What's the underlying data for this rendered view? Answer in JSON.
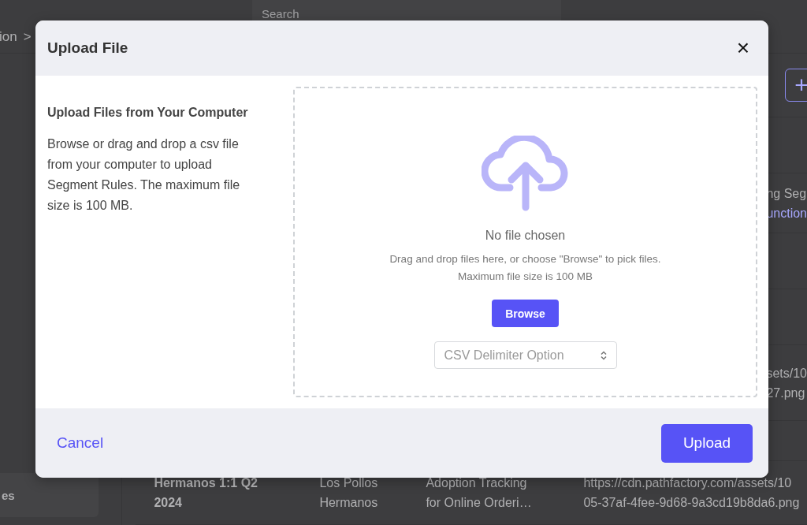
{
  "background": {
    "search": {
      "placeholder": "Search"
    },
    "breadcrumb": {
      "crumb": "ion",
      "separator": ">"
    },
    "add_button": "+",
    "sidebar_item": "es",
    "table_rows": [
      {
        "column_5": "ng Seg",
        "column_5_link": "unction"
      },
      {
        "column_5": "sets/10\n27.png"
      },
      {
        "column_1": "Hermanos 1:1 Q2\n2024",
        "column_2": "Los Pollos\nHermanos",
        "column_3": "Adoption Tracking\nfor Online Orderi…",
        "column_4": "https://cdn.pathfactory.com/assets/10\n05-37af-4fee-9d68-9a3cd19b8da6.png"
      }
    ]
  },
  "modal": {
    "title": "Upload File",
    "close": "×",
    "heading": "Upload Files from Your Computer",
    "description": "Browse or drag and drop a csv file from your computer to upload Segment Rules. The maximum file size is 100 MB.",
    "dropzone": {
      "status": "No file chosen",
      "hint": "Drag and drop files here, or choose \"Browse\" to pick files.",
      "limit": "Maximum file size is 100 MB",
      "browse_button": "Browse",
      "delimiter_select": {
        "placeholder": "CSV Delimiter Option"
      }
    },
    "cancel": "Cancel",
    "upload": "Upload"
  }
}
